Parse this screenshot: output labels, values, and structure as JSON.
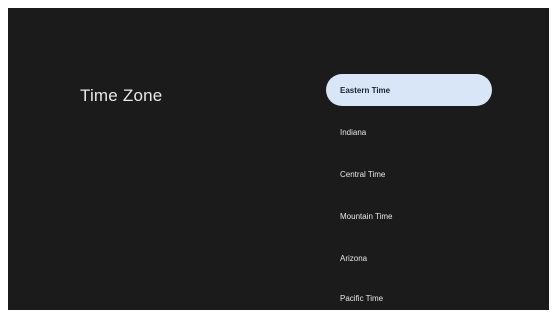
{
  "page": {
    "title": "Time Zone"
  },
  "options": [
    {
      "label": "Eastern Time",
      "selected": true
    },
    {
      "label": "Indiana",
      "selected": false
    },
    {
      "label": "Central Time",
      "selected": false
    },
    {
      "label": "Mountain Time",
      "selected": false
    },
    {
      "label": "Arizona",
      "selected": false
    },
    {
      "label": "Pacific Time",
      "selected": false
    }
  ],
  "colors": {
    "background": "#1b1b1b",
    "selected_fill": "#d9e6f7",
    "selected_text": "#1b2430",
    "text": "#e6e6e6"
  }
}
